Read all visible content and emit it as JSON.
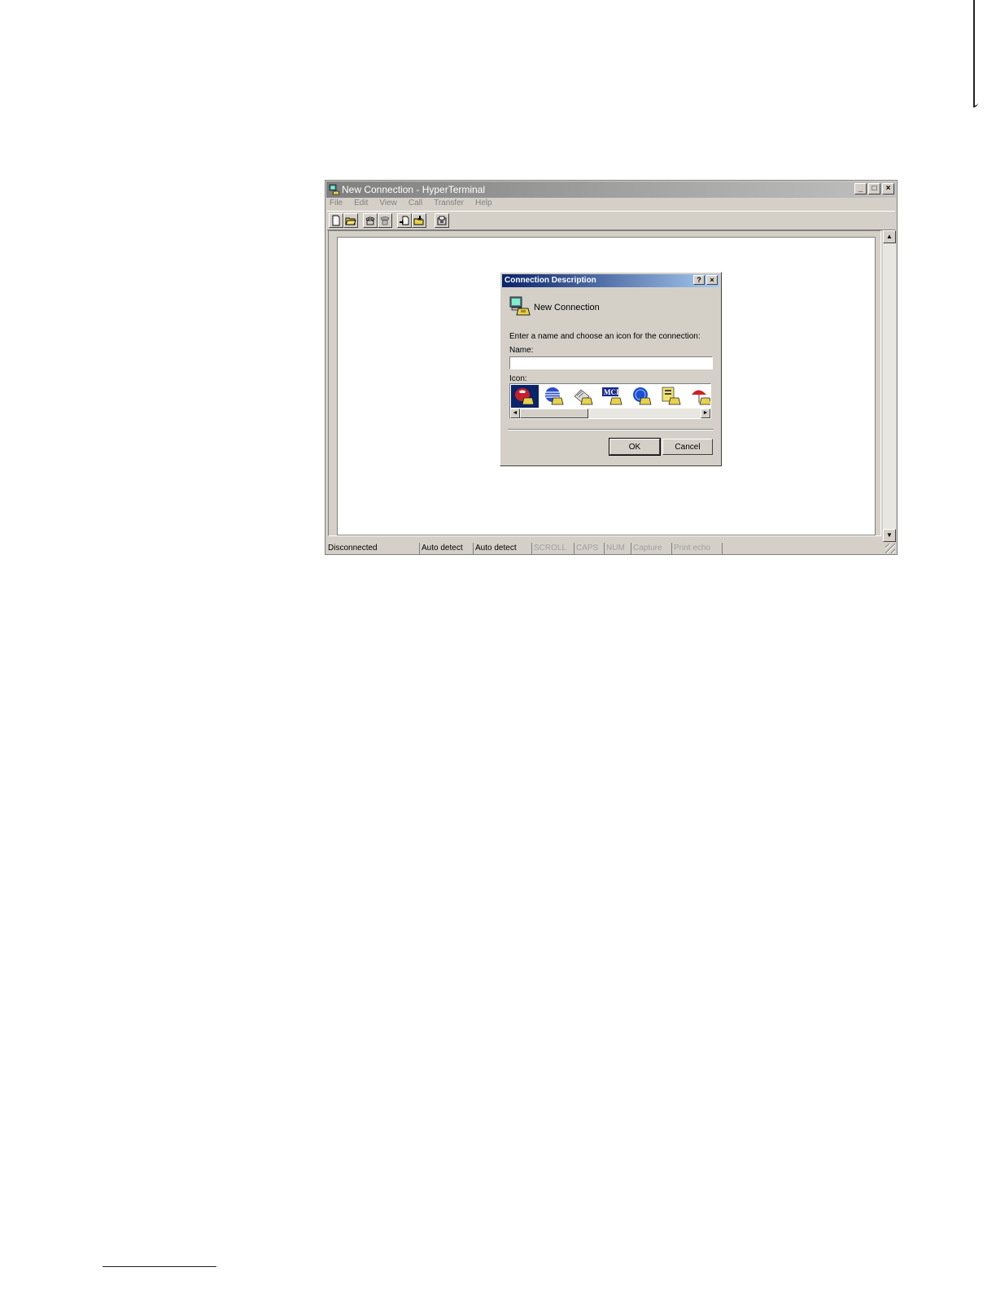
{
  "window": {
    "title": "New Connection - HyperTerminal",
    "controls": {
      "minimize": "_",
      "maximize": "□",
      "close": "×"
    }
  },
  "menu": [
    "File",
    "Edit",
    "View",
    "Call",
    "Transfer",
    "Help"
  ],
  "toolbar": {
    "buttons": [
      "new-icon",
      "open-icon",
      "phone-icon",
      "hangup-icon",
      "send-icon",
      "receive-icon",
      "properties-icon"
    ]
  },
  "scrollbar": {
    "up": "▲",
    "down": "▼"
  },
  "statusbar": {
    "connection": "Disconnected",
    "detect1": "Auto detect",
    "detect2": "Auto detect",
    "scroll": "SCROLL",
    "caps": "CAPS",
    "num": "NUM",
    "capture": "Capture",
    "print_echo": "Print echo"
  },
  "dialog": {
    "title": "Connection Description",
    "help_btn": "?",
    "close_btn": "×",
    "heading": "New Connection",
    "instruction": "Enter a name and choose an icon for the connection:",
    "name_label": "Name:",
    "name_value": "",
    "icon_label": "Icon:",
    "icons": [
      "red-phone-icon",
      "globe-icon",
      "fax-icon",
      "mci-icon",
      "blue-globe-icon",
      "document-icon",
      "umbrella-icon"
    ],
    "selected_icon_index": 0,
    "scroll_left": "◄",
    "scroll_right": "►",
    "ok_label": "OK",
    "cancel_label": "Cancel"
  },
  "colors": {
    "face": "#d4d0c8",
    "dialog_title_start": "#0a246a",
    "dialog_title_end": "#a6caf0",
    "inactive_title_start": "#808080"
  }
}
